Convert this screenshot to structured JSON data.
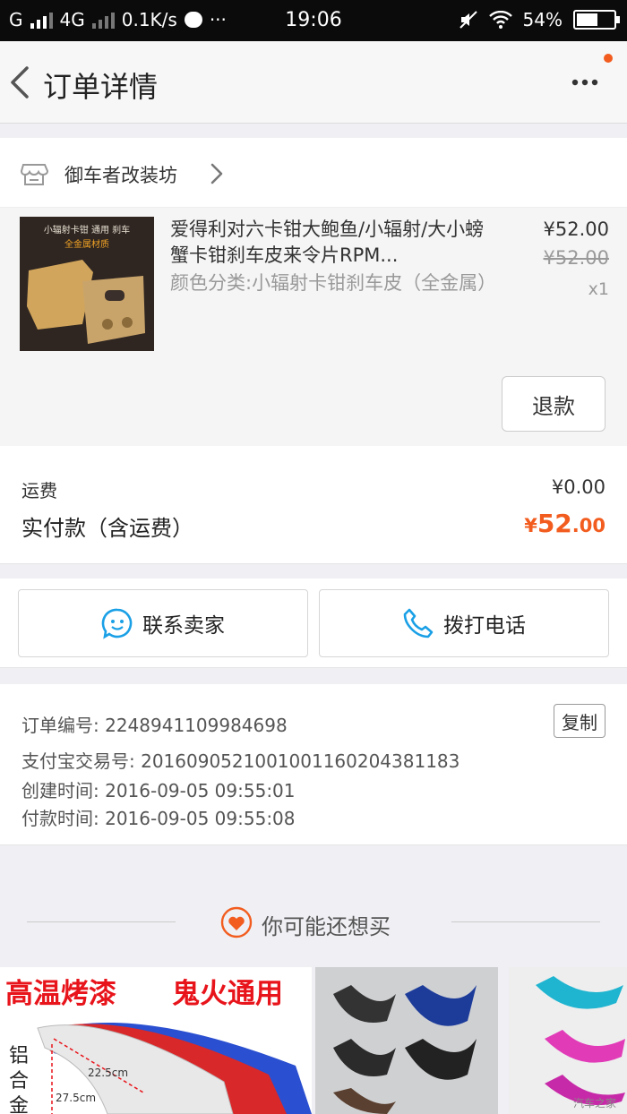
{
  "status_bar": {
    "carrier": "G",
    "network": "4G",
    "speed": "0.1K/s",
    "time": "19:06",
    "battery": "54%",
    "battery_level": 0.54
  },
  "nav": {
    "title": "订单详情"
  },
  "shop": {
    "name": "御车者改装坊"
  },
  "item": {
    "title": "爱得利对六卡钳大鲍鱼/小辐射/大小螃蟹卡钳刹车皮来令片RPM...",
    "sku": "颜色分类:小辐射卡钳刹车皮（全金属）",
    "price": "¥52.00",
    "original_price": "¥52.00",
    "quantity": "x1",
    "thumb_text_line1": "小辐射卡钳 通用 刹车",
    "thumb_text_line2": "全金属材质",
    "refund_label": "退款"
  },
  "fees": {
    "shipping_label": "运费",
    "shipping_value": "¥0.00",
    "paid_label": "实付款（含运费）",
    "paid_currency": "¥",
    "paid_int": "52",
    "paid_dec": ".00"
  },
  "actions": {
    "contact_label": "联系卖家",
    "call_label": "拨打电话"
  },
  "order_info": {
    "order_no": "订单编号: 2248941109984698",
    "alipay_no": "支付宝交易号: 2016090521001001160204381183",
    "created": "创建时间: 2016-09-05 09:55:01",
    "paid": "付款时间: 2016-09-05 09:55:08",
    "copy_label": "复制"
  },
  "recommend": {
    "title": "你可能还想买",
    "tile1_tag_left": "高温烤漆",
    "tile1_tag_right": "鬼火通用",
    "tile1_side": "铝合金",
    "tile1_dim1": "22.5cm",
    "tile1_dim2": "27.5cm"
  },
  "watermark": "汽车之家",
  "colors": {
    "accent": "#f25c1e",
    "chat_blue": "#1aa0e6",
    "tag_red": "#e8141b"
  }
}
